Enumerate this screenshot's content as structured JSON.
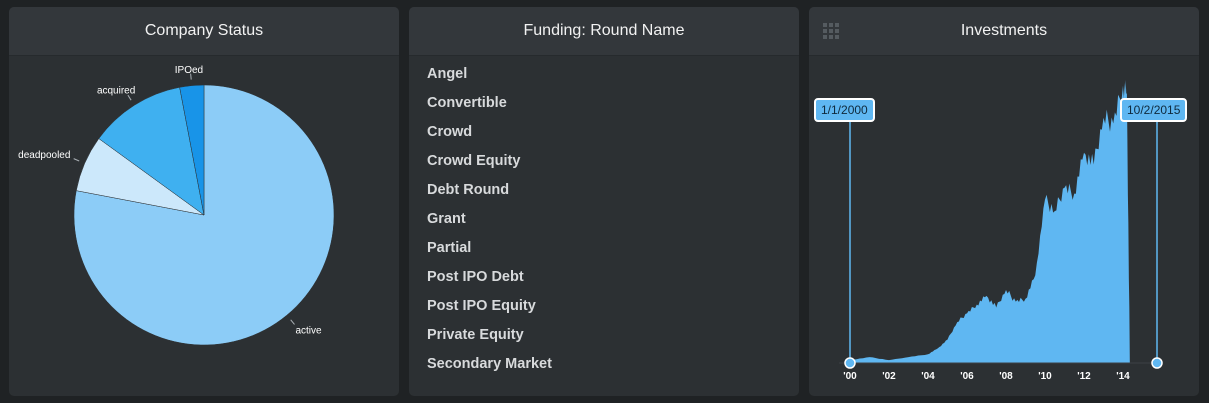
{
  "panels": {
    "company_status": {
      "title": "Company Status",
      "slices": [
        {
          "label": "active",
          "value": 78,
          "color": "#8cccf7"
        },
        {
          "label": "deadpooled",
          "value": 7,
          "color": "#cce8fb"
        },
        {
          "label": "acquired",
          "value": 12,
          "color": "#3fb0f0"
        },
        {
          "label": "IPOed",
          "value": 3,
          "color": "#1894e8"
        }
      ]
    },
    "funding_round": {
      "title": "Funding: Round Name",
      "items": [
        "Angel",
        "Convertible",
        "Crowd",
        "Crowd Equity",
        "Debt Round",
        "Grant",
        "Partial",
        "Post IPO Debt",
        "Post IPO Equity",
        "Private Equity",
        "Secondary Market"
      ]
    },
    "investments": {
      "title": "Investments",
      "range_start": "1/1/2000",
      "range_end": "10/2/2015",
      "fill_color": "#5fb7f2"
    }
  },
  "chart_data": [
    {
      "type": "pie",
      "title": "Company Status",
      "categories": [
        "active",
        "deadpooled",
        "acquired",
        "IPOed"
      ],
      "values": [
        78,
        7,
        12,
        3
      ]
    },
    {
      "type": "area",
      "title": "Investments",
      "xlabel": "",
      "ylabel": "",
      "x_tick_labels": [
        "'00",
        "'02",
        "'04",
        "'06",
        "'08",
        "'10",
        "'12",
        "'14"
      ],
      "x": [
        2000.0,
        2001.0,
        2002.0,
        2003.0,
        2004.0,
        2004.5,
        2005.0,
        2005.5,
        2006.0,
        2006.5,
        2007.0,
        2007.5,
        2008.0,
        2008.5,
        2009.0,
        2009.5,
        2010.0,
        2010.5,
        2011.0,
        2011.5,
        2012.0,
        2012.5,
        2013.0,
        2013.5,
        2014.0,
        2014.2,
        2014.35
      ],
      "values": [
        1,
        2,
        1,
        2,
        3,
        5,
        8,
        14,
        17,
        20,
        23,
        19,
        25,
        21,
        22,
        30,
        56,
        52,
        60,
        58,
        72,
        68,
        84,
        82,
        95,
        92,
        0
      ],
      "ylim": [
        0,
        100
      ]
    }
  ]
}
